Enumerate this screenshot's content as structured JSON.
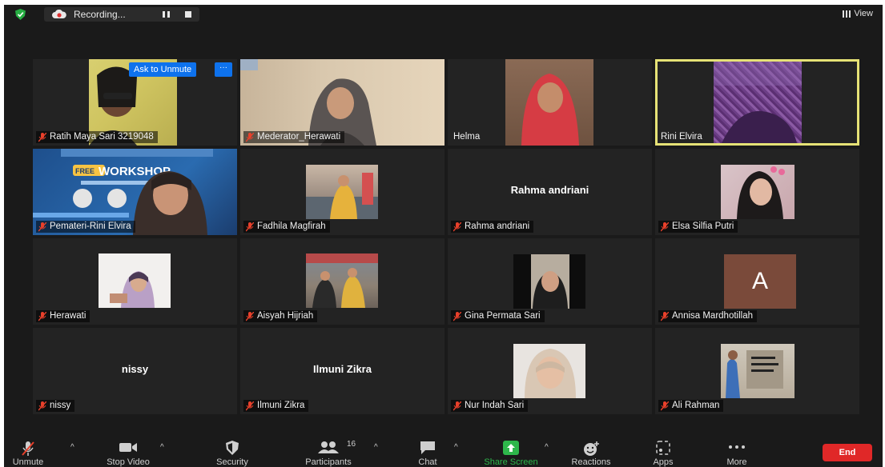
{
  "topbar": {
    "recording_label": "Recording...",
    "view_label": "View"
  },
  "participants": [
    {
      "name": "Ratih Maya Sari 3219048",
      "muted": true
    },
    {
      "name": "Mederator_Herawati",
      "muted": true
    },
    {
      "name": "Helma",
      "muted": false
    },
    {
      "name": "Rini Elvira",
      "muted": false,
      "active_speaker": true
    },
    {
      "name": "Pemateri-Rini Elvira",
      "muted": true
    },
    {
      "name": "Fadhila Magfirah",
      "muted": true
    },
    {
      "name": "Rahma andriani",
      "muted": true,
      "display_text": "Rahma andriani"
    },
    {
      "name": "Elsa Silfia Putri",
      "muted": true
    },
    {
      "name": "Herawati",
      "muted": true
    },
    {
      "name": "Aisyah Hijriah",
      "muted": true
    },
    {
      "name": "Gina Permata Sari",
      "muted": true
    },
    {
      "name": "Annisa Mardhotillah",
      "muted": true,
      "avatar_letter": "A"
    },
    {
      "name": "nissy",
      "muted": true,
      "display_text": "nissy"
    },
    {
      "name": "Ilmuni Zikra",
      "muted": true,
      "display_text": "Ilmuni Zikra"
    },
    {
      "name": "Nur Indah Sari",
      "muted": true
    },
    {
      "name": "Ali Rahman",
      "muted": true
    }
  ],
  "hover_controls": {
    "ask_to_unmute": "Ask to Unmute",
    "more": "···"
  },
  "toolbar": {
    "unmute": "Unmute",
    "stop_video": "Stop Video",
    "security": "Security",
    "participants": "Participants",
    "participant_count": "16",
    "chat": "Chat",
    "share_screen": "Share Screen",
    "reactions": "Reactions",
    "apps": "Apps",
    "more": "More",
    "end": "End"
  },
  "colors": {
    "share_green": "#2eb74b",
    "end_red": "#e02828",
    "active_speaker_border": "#e6e276",
    "unmute_blue": "#0e72ed",
    "muted_mic_red": "#e8402b"
  },
  "tile_banner": {
    "workshop": "WORKSHOP",
    "free": "FREE"
  }
}
